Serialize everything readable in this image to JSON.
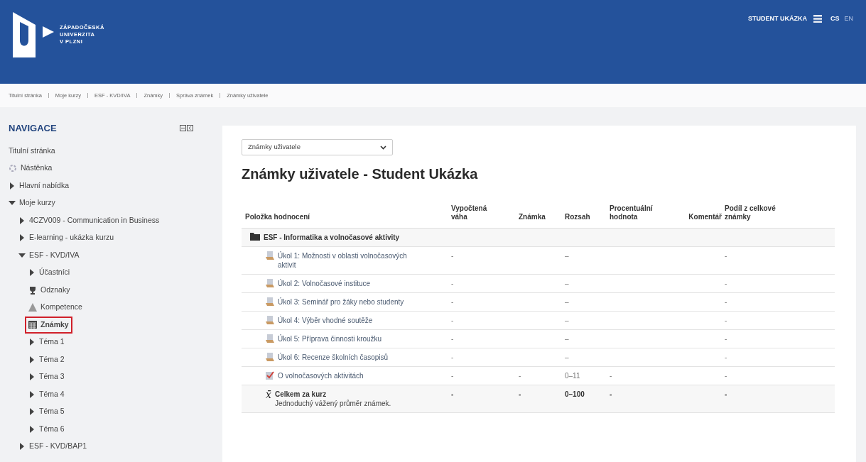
{
  "header": {
    "logo_lines": [
      "ZÁPADOČESKÁ",
      "UNIVERZITA",
      "V PLZNI"
    ],
    "user": "STUDENT UKÁZKA",
    "languages": [
      {
        "label": "CS",
        "selected": true
      },
      {
        "label": "EN",
        "selected": false
      }
    ]
  },
  "breadcrumb": [
    "Titulní stránka",
    "Moje kurzy",
    "ESF - KVD/IVA",
    "Známky",
    "Správa známek",
    "Známky uživatele"
  ],
  "navigation": {
    "title": "NAVIGACE",
    "items": [
      {
        "label": "Titulní stránka",
        "kind": "link",
        "selected": false
      },
      {
        "label": "Nástěnka",
        "kind": "dashboard",
        "selected": false
      },
      {
        "label": "Hlavní nabídka",
        "kind": "branch",
        "expanded": false,
        "selected": false
      },
      {
        "label": "Moje kurzy",
        "kind": "branch",
        "expanded": true,
        "selected": false,
        "children": [
          {
            "label": "4CZV009 - Communication in Business",
            "kind": "branch",
            "expanded": false,
            "selected": false
          },
          {
            "label": "E-learning - ukázka kurzu",
            "kind": "branch",
            "expanded": false,
            "selected": false
          },
          {
            "label": "ESF - KVD/IVA",
            "kind": "branch",
            "expanded": true,
            "selected": false,
            "children": [
              {
                "label": "Účastníci",
                "kind": "branch",
                "expanded": false,
                "selected": false
              },
              {
                "label": "Odznaky",
                "kind": "badge",
                "selected": false
              },
              {
                "label": "Kompetence",
                "kind": "competency",
                "selected": false
              },
              {
                "label": "Známky",
                "kind": "grades",
                "selected": true
              },
              {
                "label": "Téma 1",
                "kind": "branch",
                "expanded": false,
                "selected": false
              },
              {
                "label": "Téma 2",
                "kind": "branch",
                "expanded": false,
                "selected": false
              },
              {
                "label": "Téma 3",
                "kind": "branch",
                "expanded": false,
                "selected": false
              },
              {
                "label": "Téma 4",
                "kind": "branch",
                "expanded": false,
                "selected": false
              },
              {
                "label": "Téma 5",
                "kind": "branch",
                "expanded": false,
                "selected": false
              },
              {
                "label": "Téma 6",
                "kind": "branch",
                "expanded": false,
                "selected": false
              }
            ]
          },
          {
            "label": "ESF - KVD/BAP1",
            "kind": "branch",
            "expanded": false,
            "selected": false
          }
        ]
      }
    ]
  },
  "report_select": {
    "value": "Známky uživatele"
  },
  "title": "Známky uživatele - Student Ukázka",
  "table": {
    "columns": [
      "Položka hodnocení",
      "Vypočtená váha",
      "Známka",
      "Rozsah",
      "Procentuální hodnota",
      "Komentář",
      "Podíl z celkové známky"
    ],
    "rows": [
      {
        "kind": "category",
        "item": "ESF - Informatika a volnočasové aktivity"
      },
      {
        "kind": "assignment",
        "item": "Úkol 1: Možnosti v oblasti volnočasových aktivit",
        "weight": "-",
        "range": "–",
        "share": "-"
      },
      {
        "kind": "assignment",
        "item": "Úkol 2: Volnočasové instituce",
        "weight": "-",
        "range": "–",
        "share": "-"
      },
      {
        "kind": "assignment",
        "item": "Úkol 3: Seminář pro žáky nebo studenty",
        "weight": "-",
        "range": "–",
        "share": "-"
      },
      {
        "kind": "assignment",
        "item": "Úkol 4: Výběr vhodné soutěže",
        "weight": "-",
        "range": "–",
        "share": "-"
      },
      {
        "kind": "assignment",
        "item": "Úkol 5: Příprava činnosti kroužku",
        "weight": "-",
        "range": "–",
        "share": "-"
      },
      {
        "kind": "assignment",
        "item": "Úkol 6: Recenze školních časopisů",
        "weight": "-",
        "range": "–",
        "share": "-"
      },
      {
        "kind": "quiz",
        "item": "O volnočasových aktivitách",
        "weight": "-",
        "grade": "-",
        "range": "0–11",
        "percent": "-",
        "share": "-"
      },
      {
        "kind": "total",
        "symbol": "x̄",
        "item": "Celkem za kurz",
        "note": "Jednoduchý vážený průměr známek.",
        "weight": "-",
        "grade": "-",
        "range": "0–100",
        "percent": "-",
        "share": "-"
      }
    ]
  }
}
